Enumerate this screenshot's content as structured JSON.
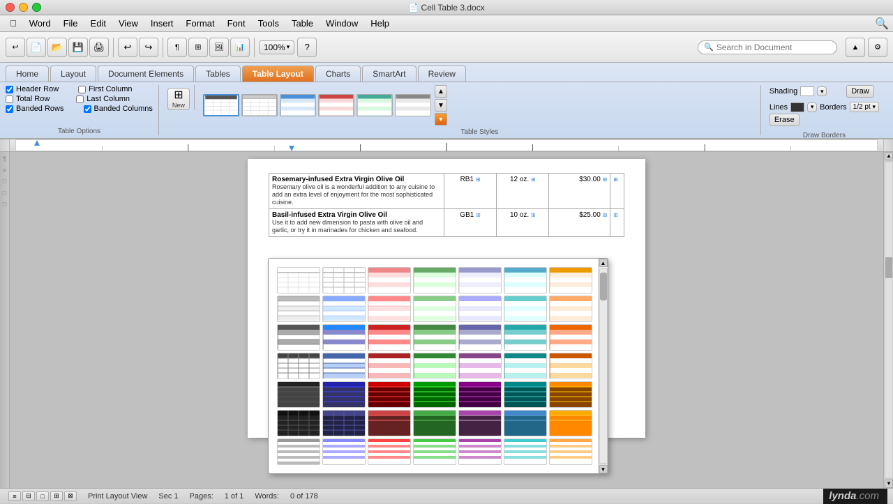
{
  "window": {
    "title": "Cell Table 3.docx",
    "controls": [
      "close",
      "minimize",
      "maximize"
    ]
  },
  "menubar": {
    "apple": "⌘",
    "items": [
      "Word",
      "File",
      "Edit",
      "View",
      "Insert",
      "Format",
      "Font",
      "Tools",
      "Table",
      "Window",
      "Help"
    ]
  },
  "toolbar": {
    "zoom": "100%",
    "search_placeholder": "Search in Document"
  },
  "ribbon": {
    "tabs": [
      "Home",
      "Layout",
      "Document Elements",
      "Tables",
      "Table Layout",
      "Charts",
      "SmartArt",
      "Review"
    ],
    "active_tab": "Table Layout",
    "table_options_label": "Table Options",
    "table_styles_label": "Table Styles",
    "draw_borders_label": "Draw Borders",
    "options": {
      "header_row": true,
      "total_row": false,
      "banded_rows": true,
      "first_column": false,
      "last_column": false,
      "banded_columns": true
    },
    "option_labels": {
      "header_row": "Header Row",
      "total_row": "Total Row",
      "banded_rows": "Banded Rows",
      "first_column": "First Column",
      "last_column": "Last Column",
      "banded_columns": "Banded Columns"
    },
    "shading_label": "Shading",
    "lines_label": "Lines",
    "borders_label": "Borders",
    "line_thickness": "1/2 pt",
    "draw_label": "Draw",
    "erase_label": "Erase",
    "new_label": "New"
  },
  "dropdown": {
    "visible": true,
    "rows": 7,
    "cols": 7,
    "styles": [
      {
        "type": "plain-light"
      },
      {
        "type": "blue-light"
      },
      {
        "type": "red-light"
      },
      {
        "type": "green-light"
      },
      {
        "type": "purple-light"
      },
      {
        "type": "teal-light"
      },
      {
        "type": "orange-light"
      },
      {
        "type": "plain-medium"
      },
      {
        "type": "blue-medium"
      },
      {
        "type": "red-medium"
      },
      {
        "type": "green-medium"
      },
      {
        "type": "purple-medium"
      },
      {
        "type": "teal-medium"
      },
      {
        "type": "orange-medium"
      },
      {
        "type": "plain-dark"
      },
      {
        "type": "blue-dark"
      },
      {
        "type": "red-dark"
      },
      {
        "type": "green-dark"
      },
      {
        "type": "purple-dark"
      },
      {
        "type": "teal-dark"
      },
      {
        "type": "orange-dark"
      },
      {
        "type": "plain-med2"
      },
      {
        "type": "blue-med2"
      },
      {
        "type": "red-med2"
      },
      {
        "type": "green-med2"
      },
      {
        "type": "purple-med2"
      },
      {
        "type": "teal-med2"
      },
      {
        "type": "orange-med2"
      },
      {
        "type": "plain-dk2"
      },
      {
        "type": "blue-dk2"
      },
      {
        "type": "red-dk2"
      },
      {
        "type": "green-dk2"
      },
      {
        "type": "purple-dk2"
      },
      {
        "type": "teal-dk2"
      },
      {
        "type": "orange-dk2"
      },
      {
        "type": "plain-dk3"
      },
      {
        "type": "blue-dk3"
      },
      {
        "type": "red-dk3"
      },
      {
        "type": "green-dk3"
      },
      {
        "type": "purple-dk3"
      },
      {
        "type": "teal-dk3"
      },
      {
        "type": "orange-dk3"
      },
      {
        "type": "plain-stripe"
      },
      {
        "type": "blue-stripe"
      },
      {
        "type": "red-stripe"
      },
      {
        "type": "green-stripe"
      },
      {
        "type": "purple-stripe"
      },
      {
        "type": "teal-stripe"
      },
      {
        "type": "orange-stripe"
      }
    ]
  },
  "document": {
    "rows": [
      {
        "product": "Rosemary-infused Extra Virgin Olive Oil",
        "description": "Rosemary olive oil is a wonderful addition to any cuisine to add an extra level of enjoyment for the most sophisticated cuisine.",
        "code": "RB1",
        "size": "12 oz.",
        "price": "$30.00"
      },
      {
        "product": "Basil-infused Extra Virgin Olive Oil",
        "description": "Use it to add new dimension to pasta with olive oil and garlic, or try it in marinades for chicken and seafood.",
        "code": "GB1",
        "size": "10 oz.",
        "price": "$25.00"
      }
    ]
  },
  "statusbar": {
    "view_label": "Print Layout View",
    "sec": "Sec  1",
    "pages_label": "Pages:",
    "pages_value": "1 of 1",
    "words_label": "Words:",
    "words_value": "0 of 178",
    "lynda": "lynda.com"
  }
}
